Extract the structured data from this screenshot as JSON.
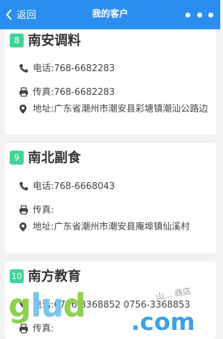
{
  "header": {
    "back_label": "返回",
    "title": "我的客户",
    "bg_color": "#2a8ef0"
  },
  "field_labels": {
    "phone": "电话:",
    "fax": "传真:",
    "address": "地址:"
  },
  "customers": [
    {
      "index": "8",
      "name": "南安调料",
      "phone": "768-6682283",
      "fax": "768-6682283",
      "address": "广东省潮州市潮安县彩塘镇潮汕公路边"
    },
    {
      "index": "9",
      "name": "南北副食",
      "phone": "768-6668043",
      "fax": "",
      "address": "广东省潮州市潮安县庵埠镇仙溪村"
    },
    {
      "index": "10",
      "name": "南方教育",
      "phone": "0756-3368852 0756-3368853",
      "fax": ""
    }
  ],
  "icons": {
    "back": "chevron-left-icon",
    "more": "more-icon",
    "phone": "phone-icon",
    "fax": "printer-icon",
    "address": "location-pin-icon"
  },
  "watermark": {
    "logo_parts": [
      "g",
      "lu",
      "d"
    ],
    "domain": ".com",
    "text": "山... 商店"
  },
  "colors": {
    "accent": "#2a8ef0",
    "badge": "#41d39a",
    "background": "#f2f2f2"
  }
}
